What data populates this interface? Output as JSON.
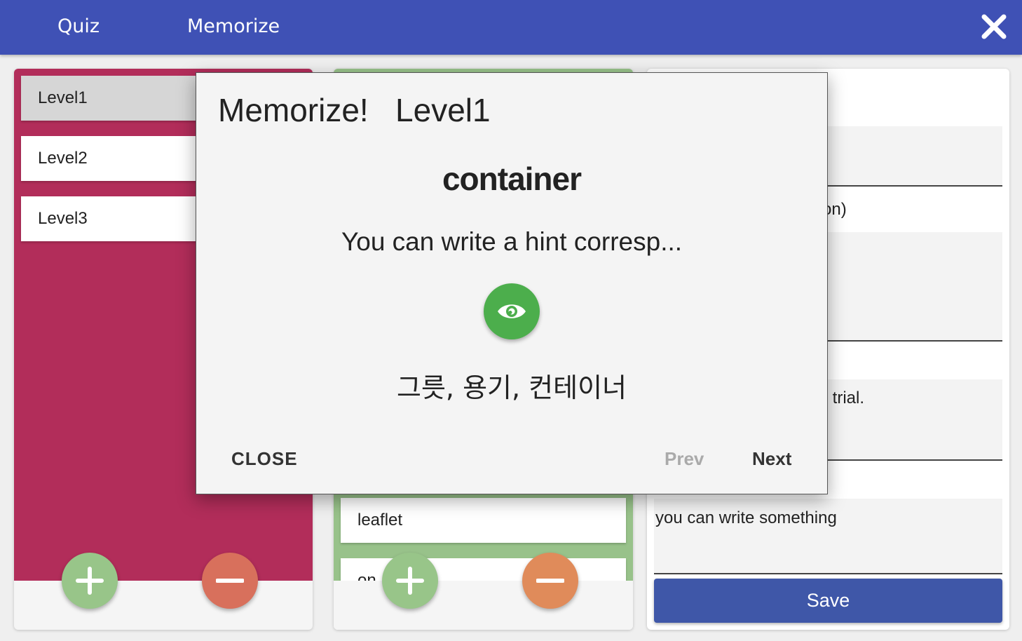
{
  "header": {
    "tabs": [
      {
        "label": "Quiz"
      },
      {
        "label": "Memorize"
      }
    ],
    "close_icon": "close-icon"
  },
  "levels": [
    {
      "label": "Level1",
      "selected": true
    },
    {
      "label": "Level2",
      "selected": false
    },
    {
      "label": "Level3",
      "selected": false
    }
  ],
  "words": {
    "items": [
      {
        "label": "leaflet"
      },
      {
        "label": "on ... r"
      }
    ]
  },
  "editor": {
    "partial_label_1": "on)",
    "partial_text_2": "r trial.",
    "memo_value": "you can write something",
    "save_label": "Save"
  },
  "dialog": {
    "title": "Memorize!   Level1",
    "word": "container",
    "hint": "You can write a hint corresp...",
    "meaning": "그릇, 용기, 컨테이너",
    "close_label": "CLOSE",
    "prev_label": "Prev",
    "next_label": "Next"
  },
  "colors": {
    "header": "#3f51b5",
    "level_panel": "#b22d5a",
    "word_panel": "#98c28a",
    "add_button": "#98c589",
    "remove_button_left": "#d8705c",
    "remove_button_mid": "#e08b5a",
    "eye_button": "#4cae4c",
    "save_button": "#3f57a8"
  }
}
